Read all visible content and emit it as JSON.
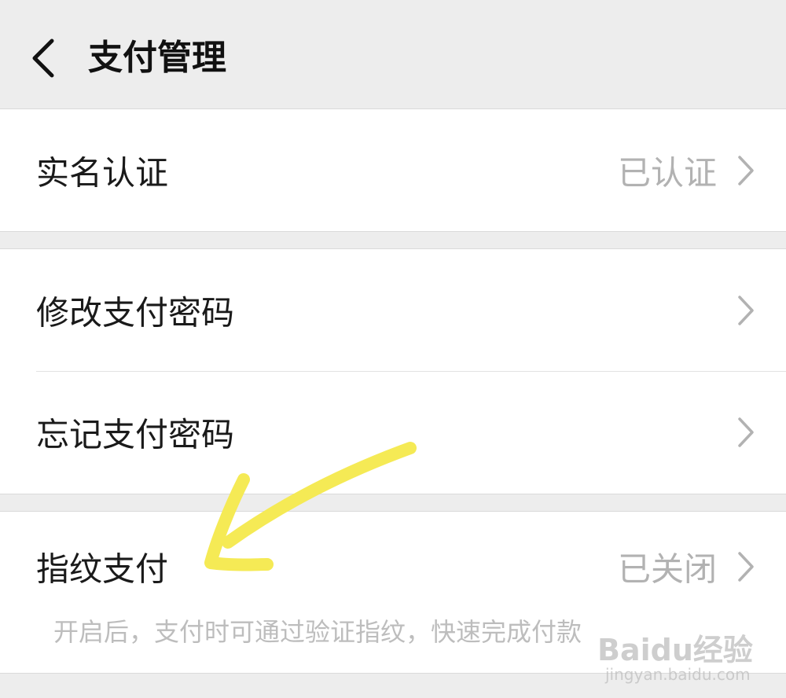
{
  "header": {
    "title": "支付管理",
    "back_icon": "chevron-left-icon"
  },
  "groups": [
    {
      "items": [
        {
          "label": "实名认证",
          "value": "已认证"
        }
      ]
    },
    {
      "items": [
        {
          "label": "修改支付密码",
          "value": ""
        },
        {
          "label": "忘记支付密码",
          "value": ""
        }
      ]
    },
    {
      "items": [
        {
          "label": "指纹支付",
          "value": "已关闭"
        }
      ],
      "hint": "开启后，支付时可通过验证指纹，快速完成付款"
    }
  ],
  "watermark": {
    "logo": "Baidu经验",
    "url": "jingyan.baidu.com"
  },
  "colors": {
    "background": "#ededed",
    "card": "#ffffff",
    "secondary_text": "#b2b2b2",
    "annotation": "#f5ea55"
  }
}
